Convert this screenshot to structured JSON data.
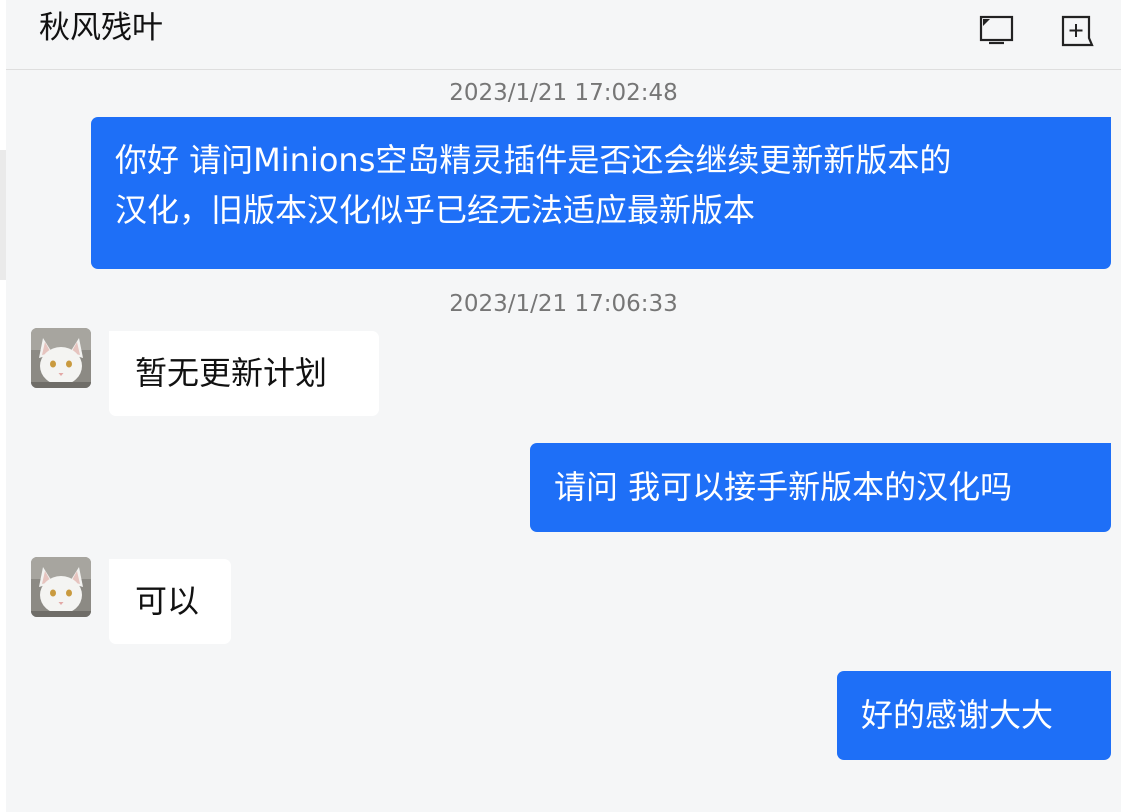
{
  "header": {
    "title": "秋风残叶",
    "icons": [
      "screen-share-icon",
      "add-panel-icon"
    ]
  },
  "messages": {
    "ts1": "2023/1/21 17:02:48",
    "m1_line1": "你好 请问Minions空岛精灵插件是否还会继续更新新版本的",
    "m1_line2": "汉化，旧版本汉化似乎已经无法适应最新版本",
    "ts2": "2023/1/21 17:06:33",
    "m2": "暂无更新计划",
    "m3": "请问 我可以接手新版本的汉化吗",
    "m4": "可以",
    "m5": "好的感谢大大"
  },
  "colors": {
    "outgoing_bubble": "#1e6ff7",
    "incoming_bubble": "#ffffff",
    "background": "#f5f6f7",
    "timestamp": "#767676"
  }
}
